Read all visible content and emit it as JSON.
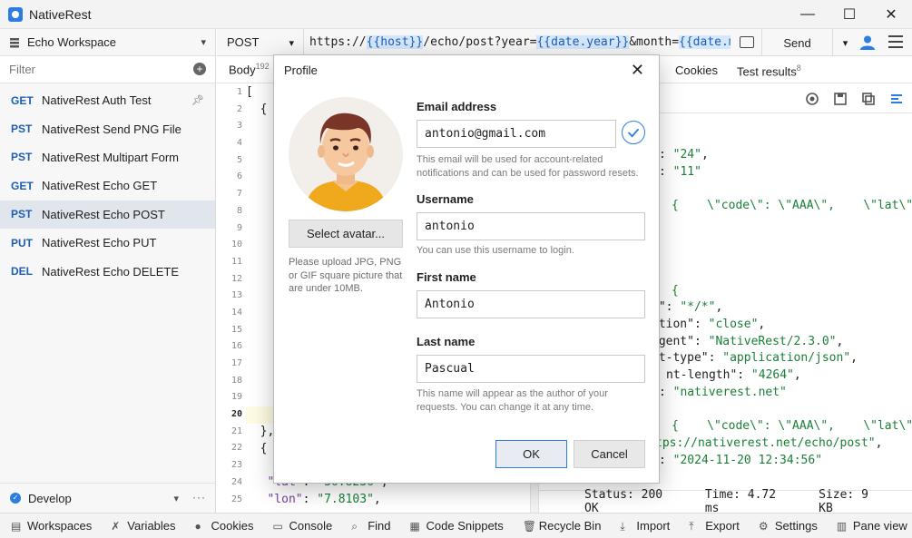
{
  "window": {
    "title": "NativeRest",
    "controls": [
      "—",
      "☐",
      "✕"
    ]
  },
  "sidebar": {
    "workspace": "Echo Workspace",
    "filter_placeholder": "Filter",
    "requests": [
      {
        "method": "GET",
        "name": "NativeRest Auth Test",
        "pinned": true
      },
      {
        "method": "PST",
        "name": "NativeRest Send PNG File"
      },
      {
        "method": "PST",
        "name": "NativeRest Multipart Form"
      },
      {
        "method": "GET",
        "name": "NativeRest Echo GET"
      },
      {
        "method": "PST",
        "name": "NativeRest Echo POST",
        "selected": true
      },
      {
        "method": "PUT",
        "name": "NativeRest Echo PUT"
      },
      {
        "method": "DEL",
        "name": "NativeRest Echo DELETE"
      }
    ],
    "environment": "Develop",
    "more": "···"
  },
  "urlbar": {
    "method": "POST",
    "url_parts": [
      {
        "t": "https://"
      },
      {
        "t": "{{host}}",
        "var": true
      },
      {
        "t": "/echo/post?year="
      },
      {
        "t": "{{date.year}}",
        "var": true
      },
      {
        "t": "&month="
      },
      {
        "t": "{{date.month}}",
        "var": true
      },
      {
        "t": "}"
      }
    ],
    "send": "Send"
  },
  "request": {
    "tabs": [
      {
        "label": "Body",
        "count": "192"
      }
    ],
    "line_numbers": [
      "1",
      "2",
      "3",
      "4",
      "5",
      "6",
      "7",
      "8",
      "9",
      "10",
      "11",
      "12",
      "13",
      "14",
      "15",
      "16",
      "17",
      "18",
      "19",
      "20",
      "21",
      "22",
      "23",
      "24",
      "25"
    ],
    "active_line": "20",
    "code": [
      {
        "line": 1,
        "text": "["
      },
      {
        "line": 2,
        "text": "  {"
      },
      {
        "line": 21,
        "text": "  },"
      },
      {
        "line": 22,
        "text": "  {"
      },
      {
        "line": 24,
        "key": "\"lat\"",
        "val": "\"36.8236\"",
        "suffix": ","
      },
      {
        "line": 25,
        "key": "\"lon\"",
        "val": "\"7.8103\"",
        "suffix": ","
      }
    ]
  },
  "response": {
    "tabs": [
      {
        "label": "Cookies",
        "count": ""
      },
      {
        "label": "Test results",
        "count": "8"
      }
    ],
    "lines": [
      {
        "y": 0,
        "pre": ": ",
        "val": "\"24\"",
        "suffix": ","
      },
      {
        "y": 1,
        "pre": ": ",
        "val": "\"11\"",
        "suffix": ""
      },
      {
        "y": 3,
        "pre": "{    \\\"code\\\": \\\"AAA\\\",    \\\"lat\\\":",
        "val": "",
        "suffix": ""
      },
      {
        "y": 8,
        "pre": "{",
        "val": "",
        "suffix": ""
      },
      {
        "y": 9,
        "pre": "t\": ",
        "val": "\"*/*\"",
        "suffix": ","
      },
      {
        "y": 10,
        "pre": "ction\": ",
        "val": "\"close\"",
        "suffix": ","
      },
      {
        "y": 11,
        "pre": "agent\": ",
        "val": "\"NativeRest/2.3.0\"",
        "suffix": ","
      },
      {
        "y": 12,
        "pre": "nt-type\": ",
        "val": "\"application/json\"",
        "suffix": ","
      },
      {
        "y": 13,
        "pre": "nt-length\": ",
        "val": "\"4264\"",
        "suffix": ","
      },
      {
        "y": 14,
        "pre": ": ",
        "val": "\"nativerest.net\"",
        "suffix": ""
      },
      {
        "y": 16,
        "pre": "{    \\\"code\\\": \\\"AAA\\\",    \\\"lat\\\":",
        "val": "",
        "suffix": ""
      },
      {
        "y": 17,
        "pre": "tps://nativerest.net/echo/post\"",
        "val": "",
        "suffix": ","
      },
      {
        "y": 18,
        "pre": ": ",
        "val": "\"2024-11-20 12:34:56\"",
        "suffix": ""
      }
    ],
    "status": "Status: 200 OK",
    "time": "Time: 4.72 ms",
    "size": "Size: 9 KB"
  },
  "bottombar": [
    "Workspaces",
    "Variables",
    "Cookies",
    "Console",
    "Find",
    "Code Snippets",
    "Recycle Bin",
    "Import",
    "Export",
    "Settings",
    "Pane view"
  ],
  "dialog": {
    "title": "Profile",
    "close": "✕",
    "select_avatar": "Select avatar...",
    "avatar_help": "Please upload JPG, PNG or GIF square picture that are under 10MB.",
    "email_label": "Email address",
    "email_value": "antonio@gmail.com",
    "email_help": "This email will be used for account-related notifications and can be used for password resets.",
    "username_label": "Username",
    "username_value": "antonio",
    "username_help": "You can use this username to login.",
    "firstname_label": "First name",
    "firstname_value": "Antonio",
    "lastname_label": "Last name",
    "lastname_value": "Pascual",
    "lastname_help": "This name will appear as the author of your requests. You can change it at any time.",
    "ok": "OK",
    "cancel": "Cancel"
  },
  "colors": {
    "accent": "#2b7de1",
    "method": "#1d5fb4",
    "json_key": "#7a3e9d",
    "json_string": "#1a7f37"
  }
}
